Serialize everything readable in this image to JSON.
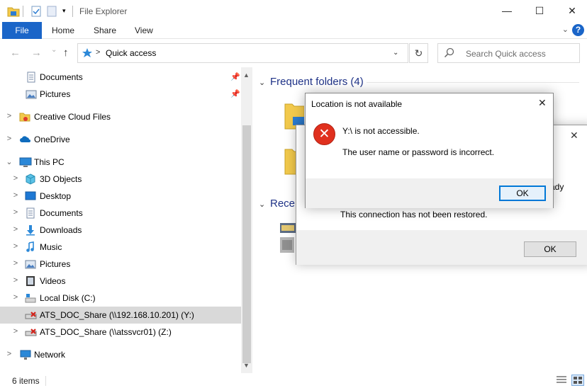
{
  "window": {
    "title": "File Explorer",
    "minimize_glyph": "—",
    "maximize_glyph": "☐",
    "close_glyph": "✕"
  },
  "ribbon": {
    "tabs": [
      "File",
      "Home",
      "Share",
      "View"
    ],
    "help_glyph": "?",
    "collapse_glyph": "⌄"
  },
  "nav": {
    "back_glyph": "←",
    "forward_glyph": "→",
    "recent_glyph": "⌄",
    "up_glyph": "↑",
    "refresh_glyph": "↻"
  },
  "address": {
    "crumb_separator": ">",
    "crumb": "Quick access",
    "dropdown_glyph": "⌄"
  },
  "search": {
    "placeholder": "Search Quick access"
  },
  "navpane": {
    "items": [
      {
        "label": "Documents",
        "icon": "documents-icon",
        "pinned": true
      },
      {
        "label": "Pictures",
        "icon": "pictures-icon",
        "pinned": true
      },
      {
        "label": "Creative Cloud Files",
        "icon": "creative-cloud-icon"
      },
      {
        "label": "OneDrive",
        "icon": "onedrive-icon"
      },
      {
        "label": "This PC",
        "icon": "this-pc-icon"
      },
      {
        "label": "3D Objects",
        "icon": "3d-objects-icon"
      },
      {
        "label": "Desktop",
        "icon": "desktop-icon"
      },
      {
        "label": "Documents",
        "icon": "documents-icon"
      },
      {
        "label": "Downloads",
        "icon": "downloads-icon"
      },
      {
        "label": "Music",
        "icon": "music-icon"
      },
      {
        "label": "Pictures",
        "icon": "pictures-icon"
      },
      {
        "label": "Videos",
        "icon": "videos-icon"
      },
      {
        "label": "Local Disk (C:)",
        "icon": "local-disk-icon"
      },
      {
        "label": "ATS_DOC_Share (\\\\192.168.10.201) (Y:)",
        "icon": "disconnected-drive-icon",
        "selected": true
      },
      {
        "label": "ATS_DOC_Share (\\\\atssvcr01) (Z:)",
        "icon": "disconnected-drive-icon"
      },
      {
        "label": "Network",
        "icon": "network-icon"
      }
    ],
    "expand_glyph": ">",
    "expanded_glyph": "⌄",
    "pin_glyph": "📌",
    "scroll_up_glyph": "▲",
    "scroll_down_glyph": "▼"
  },
  "content": {
    "frequent_heading": "Frequent folders (4)",
    "recent_heading": "Recen",
    "section_glyph": "⌄"
  },
  "status": {
    "item_count": "6 items"
  },
  "dialog_back": {
    "partial_text": "ady",
    "message": "This connection has not been restored.",
    "ok_label": "OK",
    "close_glyph": "✕"
  },
  "dialog_front": {
    "title": "Location is not available",
    "line1": "Y:\\ is not accessible.",
    "line2": "The user name or password is incorrect.",
    "ok_label": "OK",
    "close_glyph": "✕",
    "error_glyph": "✕"
  },
  "colors": {
    "accent": "#1a65c8",
    "error": "#e0301e",
    "selection": "#d9d9d9",
    "heading": "#1e3287"
  }
}
